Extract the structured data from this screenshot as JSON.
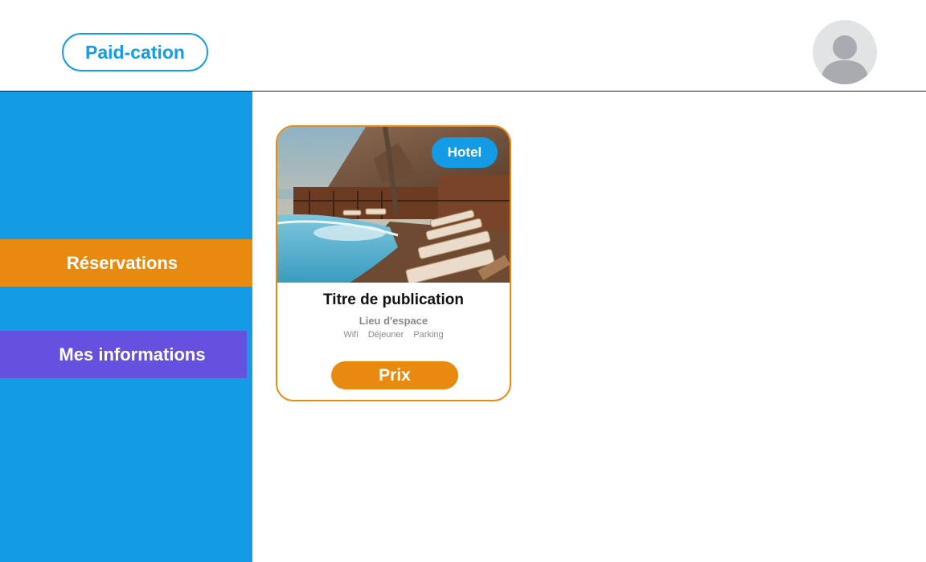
{
  "header": {
    "logo_text": "Paid-cation",
    "avatar_icon": "user-avatar-icon"
  },
  "sidebar": {
    "items": [
      {
        "label": "Réservations",
        "active": true,
        "color": "#e98a10"
      },
      {
        "label": "Mes informations",
        "active": false,
        "color": "#6651de"
      }
    ],
    "background": "#139be6"
  },
  "listing": {
    "badge": "Hotel",
    "title": "Titre de publication",
    "location": "Lieu d'espace",
    "amenities": [
      "Wifi",
      "Déjeuner",
      "Parking"
    ],
    "price_label": "Prix",
    "image": "hotel-pool-deck-photo"
  },
  "colors": {
    "accent_blue": "#139be6",
    "accent_orange": "#e98a10",
    "accent_purple": "#6651de"
  }
}
